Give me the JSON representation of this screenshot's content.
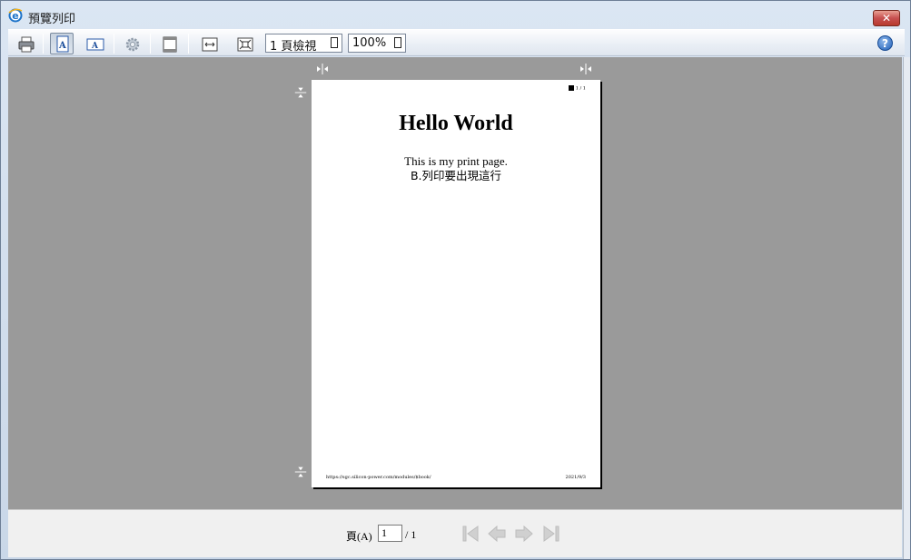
{
  "window": {
    "title": "預覽列印",
    "close_label": "✕"
  },
  "toolbar": {
    "view_mode_value": "1 頁檢視",
    "zoom_value": "100%",
    "help_label": "?"
  },
  "page": {
    "counter": "1 / 1",
    "heading": "Hello World",
    "line1": "This is my print page.",
    "line2": "B.列印要出現這行",
    "footer_url": "https://sgc.silicon-power.com/modules/$book/",
    "footer_date": "2021/9/3"
  },
  "navigation": {
    "page_label": "頁(A)",
    "current_page": "1",
    "total_pages": "/ 1"
  }
}
